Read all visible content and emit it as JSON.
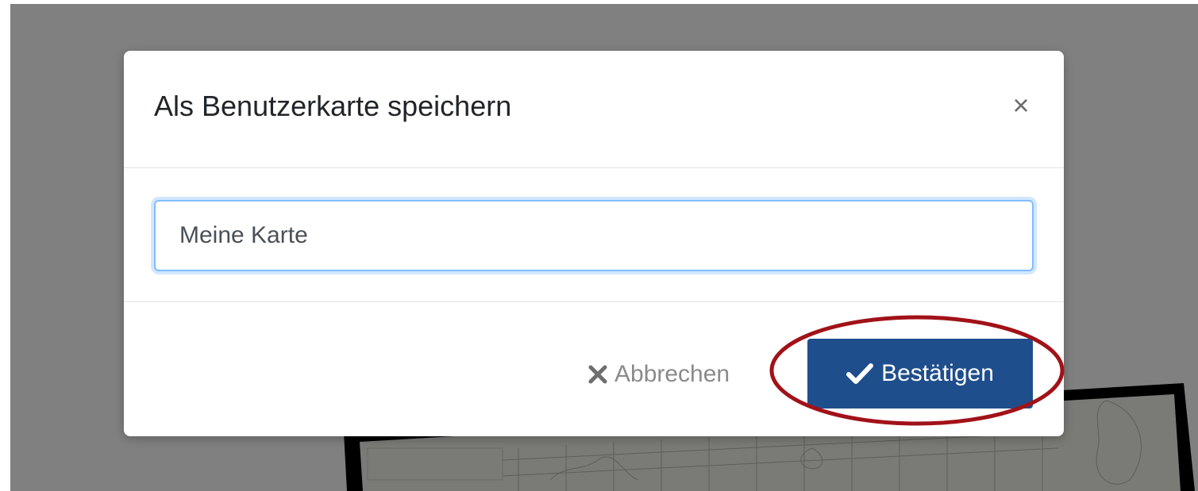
{
  "dialog": {
    "title": "Als Benutzerkarte speichern",
    "close_symbol": "×",
    "name_input": {
      "value": "Meine Karte"
    },
    "cancel_label": "Abbrechen",
    "confirm_label": "Bestätigen"
  },
  "icons": {
    "close": "close-icon",
    "cancel": "x-icon",
    "confirm": "check-icon"
  },
  "colors": {
    "overlay": "#808080",
    "confirm_button": "#1f4e8c",
    "input_focus_border": "#80bdff",
    "highlight": "#a11218"
  }
}
